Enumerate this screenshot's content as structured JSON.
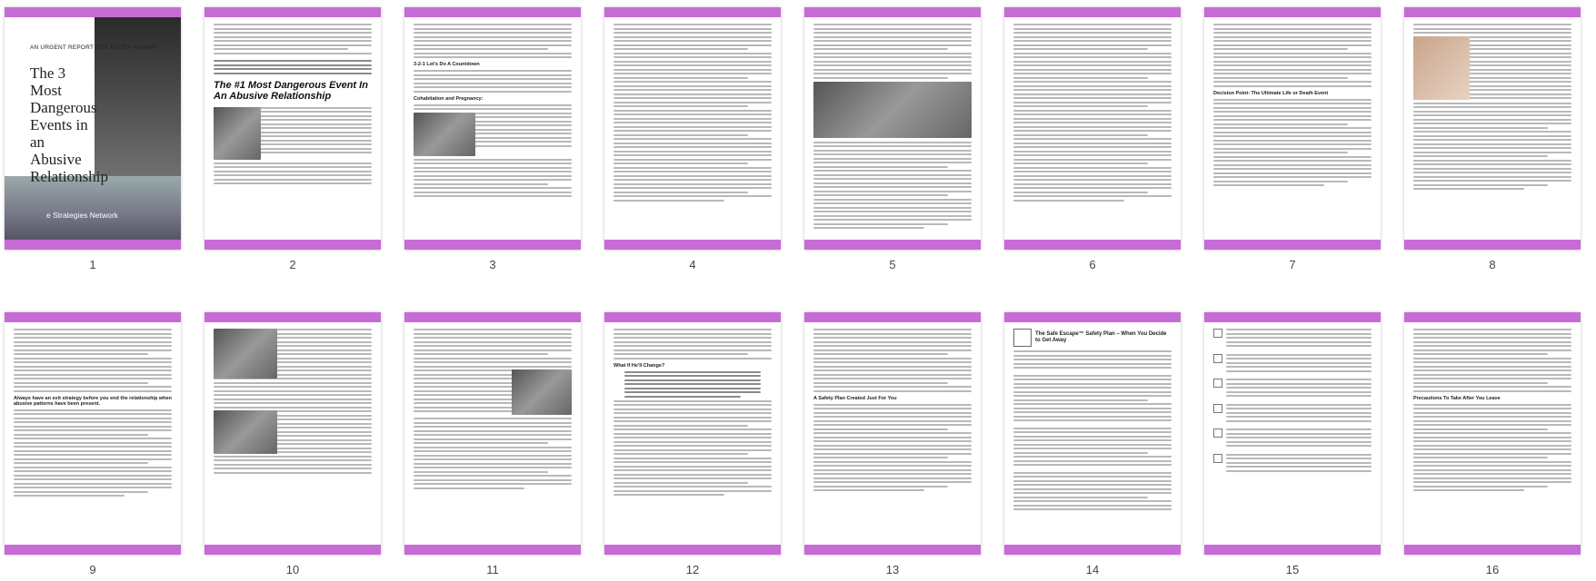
{
  "theme": {
    "accent": "#c76bd6"
  },
  "pages": [
    {
      "num": "1",
      "kind": "cover",
      "kicker": "AN URGENT REPORT FOR EVERY WOMAN",
      "title": "The 3 Most Dangerous Events in an Abusive Relationship",
      "brand": "e Strategies Network"
    },
    {
      "num": "2",
      "kind": "intro",
      "heading": "The #1 Most Dangerous Event In An Abusive Relationship"
    },
    {
      "num": "3",
      "kind": "text-img",
      "heading": "3-2-1 Let's Do A Countdown",
      "subheading": "Cohabitation and Pregnancy:"
    },
    {
      "num": "4",
      "kind": "text"
    },
    {
      "num": "5",
      "kind": "text-photo"
    },
    {
      "num": "6",
      "kind": "text"
    },
    {
      "num": "7",
      "kind": "text-section",
      "heading": "Decision Point- The Ultimate Life or Death Event"
    },
    {
      "num": "8",
      "kind": "photo-top"
    },
    {
      "num": "9",
      "kind": "text-section",
      "heading": "Always have an exit strategy before you end the relationship when abusive patterns have been present."
    },
    {
      "num": "10",
      "kind": "two-img"
    },
    {
      "num": "11",
      "kind": "text-img-r"
    },
    {
      "num": "12",
      "kind": "quote",
      "heading": "What If He'll Change?"
    },
    {
      "num": "13",
      "kind": "text-section",
      "heading": "A Safety Plan Created Just For You"
    },
    {
      "num": "14",
      "kind": "safety",
      "heading": "The Safe Escape™ Safety Plan – When You Decide to Get Away"
    },
    {
      "num": "15",
      "kind": "checklist"
    },
    {
      "num": "16",
      "kind": "text-section",
      "heading": "Precautions To Take After You Leave"
    }
  ]
}
